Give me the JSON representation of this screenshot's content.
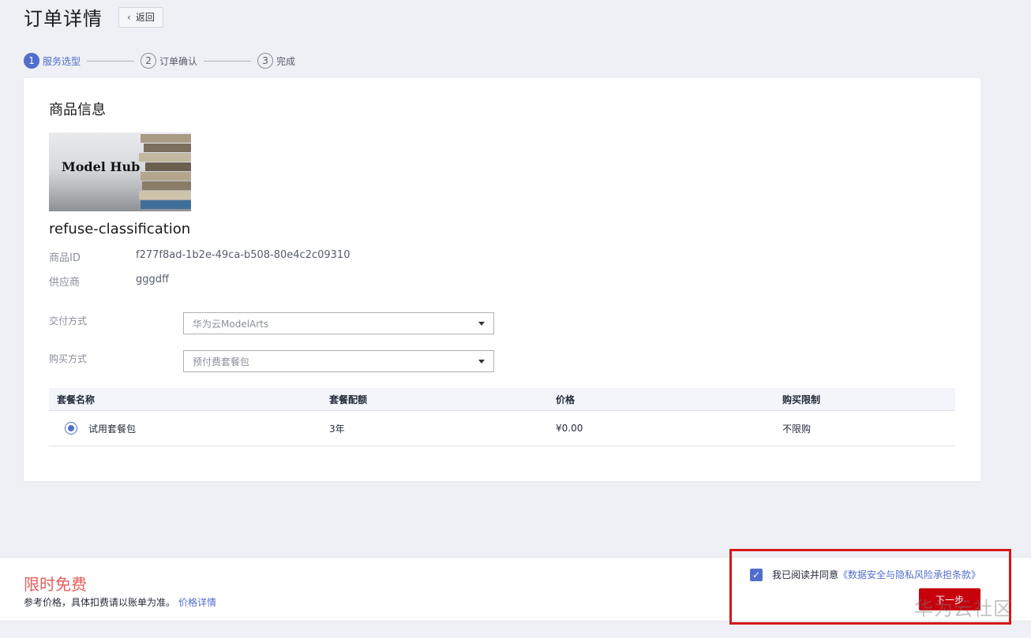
{
  "header": {
    "title": "订单详情",
    "back_label": "返回"
  },
  "steps": [
    {
      "num": "1",
      "label": "服务选型"
    },
    {
      "num": "2",
      "label": "订单确认"
    },
    {
      "num": "3",
      "label": "完成"
    }
  ],
  "product": {
    "section_title": "商品信息",
    "image_text": "Model Hub",
    "name": "refuse-classification",
    "id_label": "商品ID",
    "id_value": "f277f8ad-1b2e-49ca-b508-80e4c2c09310",
    "vendor_label": "供应商",
    "vendor_value": "gggdff"
  },
  "form": {
    "delivery_label": "交付方式",
    "delivery_value": "华为云ModelArts",
    "purchase_label": "购买方式",
    "purchase_value": "预付费套餐包"
  },
  "table": {
    "headers": [
      "套餐名称",
      "套餐配额",
      "价格",
      "购买限制"
    ],
    "rows": [
      {
        "name": "试用套餐包",
        "quota": "3年",
        "price": "¥0.00",
        "limit": "不限购"
      }
    ]
  },
  "footer": {
    "free_title": "限时免费",
    "note": "参考价格，具体扣费请以账单为准。",
    "price_link": "价格详情",
    "agree_text": "我已阅读并同意",
    "agree_link": "《数据安全与隐私风险承担条款》",
    "next_label": "下一步",
    "watermark": "华为云社区"
  },
  "colors": {
    "accent": "#526ecc",
    "brand_red": "#c7000b",
    "promo": "#e35d5d",
    "highlight_border": "#d71718"
  }
}
